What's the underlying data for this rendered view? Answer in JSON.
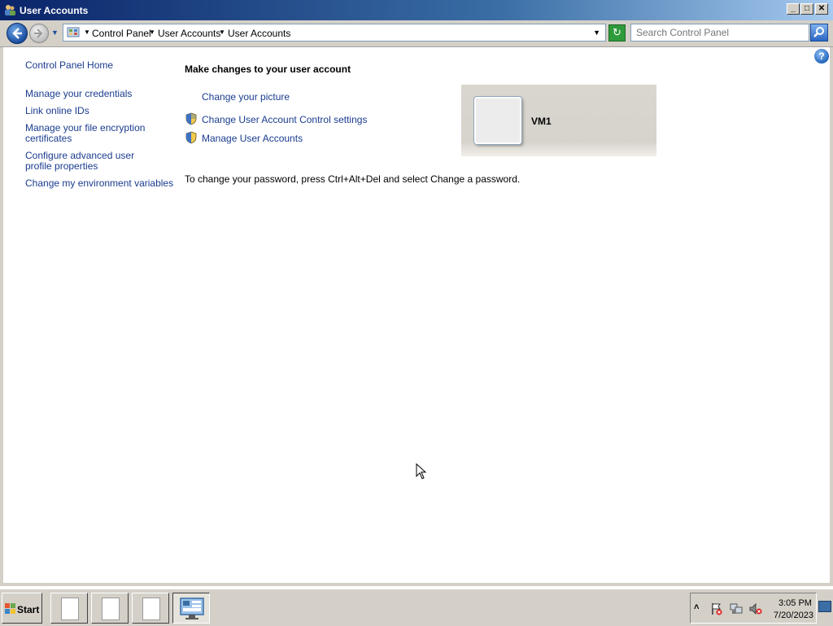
{
  "window": {
    "title": "User Accounts"
  },
  "address_bar": {
    "crumbs": [
      "Control Panel",
      "User Accounts",
      "User Accounts"
    ]
  },
  "search": {
    "placeholder": "Search Control Panel"
  },
  "sidebar": {
    "home": "Control Panel Home",
    "items": [
      {
        "label": "Manage your credentials"
      },
      {
        "label": "Link online IDs"
      },
      {
        "label": "Manage your file encryption certificates"
      },
      {
        "label": "Configure advanced user profile properties"
      },
      {
        "label": "Change my environment variables"
      }
    ]
  },
  "main": {
    "heading": "Make changes to your user account",
    "tasks": [
      {
        "label": "Change your picture",
        "icon": null
      },
      {
        "label": "Change User Account Control settings",
        "icon": "shield-icon"
      },
      {
        "label": "Manage User Accounts",
        "icon": "shield-icon"
      }
    ],
    "hint": "To change your password, press Ctrl+Alt+Del and select Change a password."
  },
  "user": {
    "name": "VM1"
  },
  "taskbar": {
    "start_label": "Start",
    "items": [
      "document-icon",
      "document-icon",
      "document-icon",
      "control-panel-icon"
    ],
    "tray_icons": [
      "chevron-up-icon",
      "action-center-flag-icon",
      "network-icon",
      "volume-muted-icon"
    ],
    "clock": {
      "time": "3:05 PM",
      "date": "7/20/2023"
    }
  },
  "colors": {
    "link": "#1a3c8f",
    "titlebar_start": "#0a246a",
    "titlebar_end": "#a6caf0",
    "chrome": "#d4d0c8"
  }
}
